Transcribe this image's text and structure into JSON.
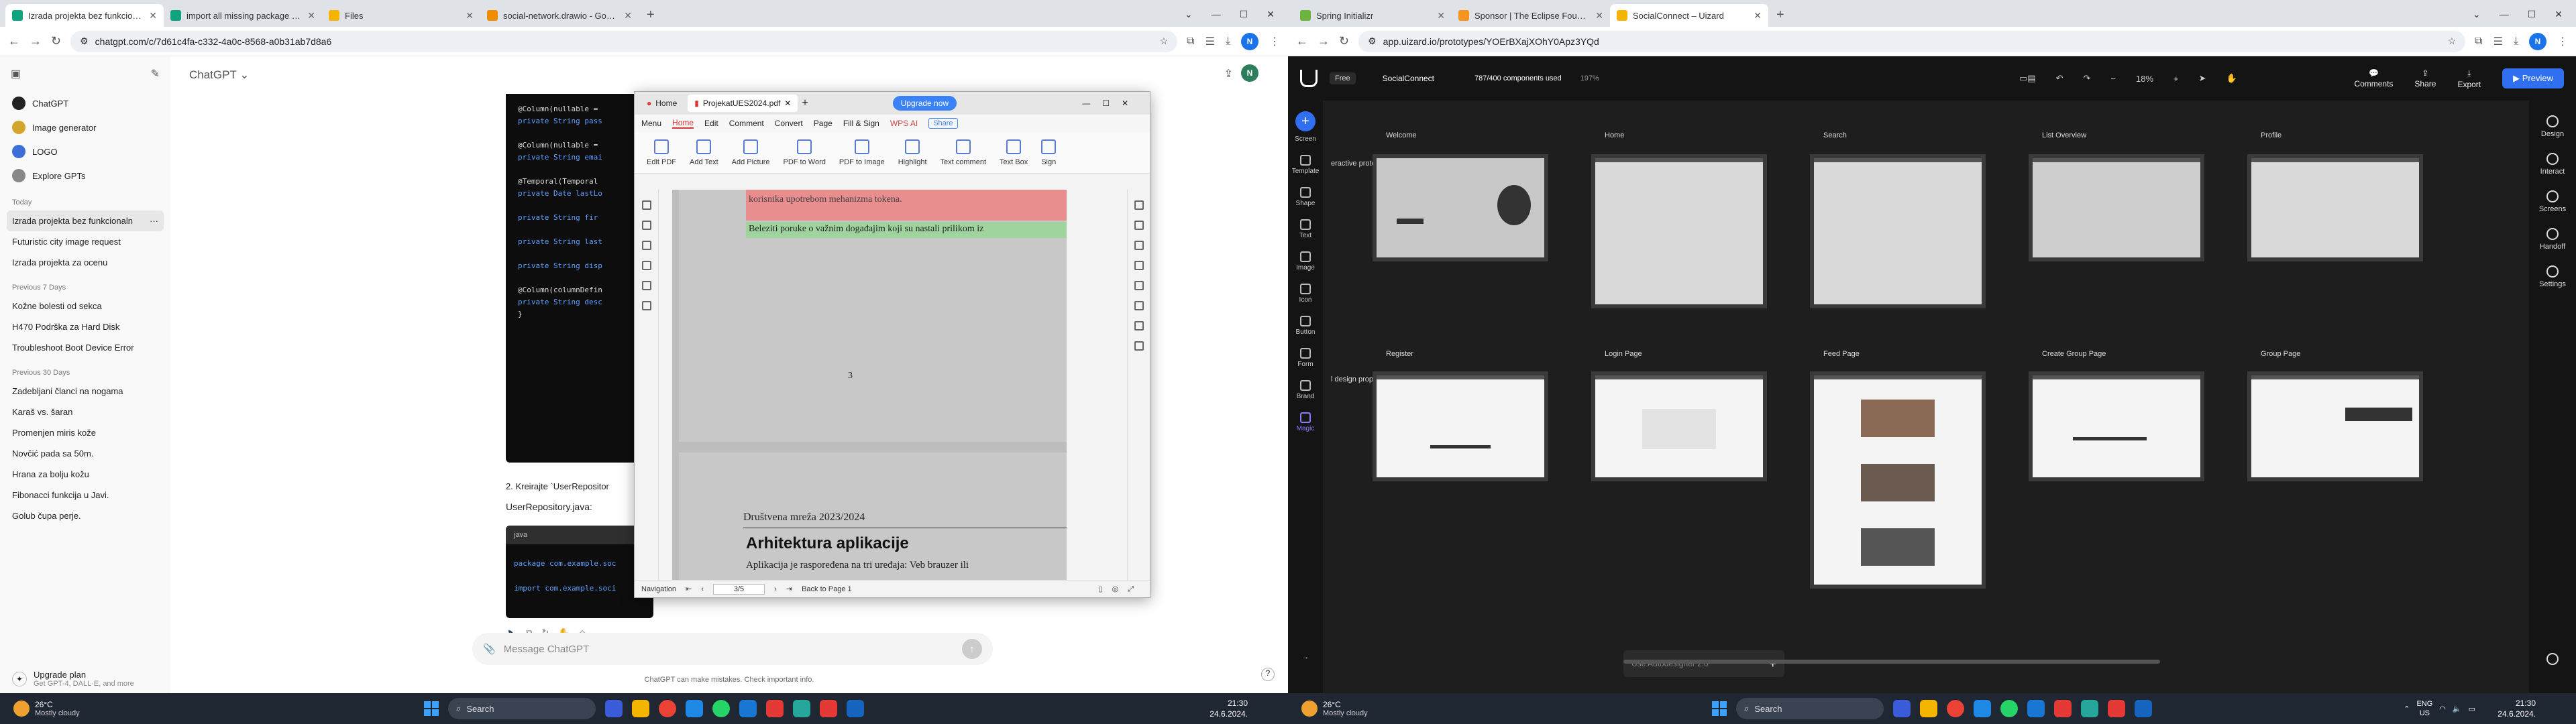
{
  "left": {
    "tabs": [
      {
        "title": "Izrada projekta bez funkcionalnosti",
        "color": "#10a37f",
        "active": true
      },
      {
        "title": "import all missing package w...",
        "color": "#10a37f"
      },
      {
        "title": "Files",
        "color": "#f4b400"
      },
      {
        "title": "social-network.drawio - Goog...",
        "color": "#f08c00"
      }
    ],
    "new_tab": "+",
    "window": {
      "minimize": "—",
      "maximize": "☐",
      "close": "✕",
      "tabsearch": "⌄"
    },
    "url": "chatgpt.com/c/7d61c4fa-c332-4a0c-8568-a0b31ab7d8a6",
    "avatar": "N",
    "sidebar": {
      "pinned": [
        {
          "label": "ChatGPT",
          "color": "#222"
        },
        {
          "label": "Image generator",
          "color": "#d4a52c"
        },
        {
          "label": "LOGO",
          "color": "#3d6fd8"
        },
        {
          "label": "Explore GPTs",
          "color": "#888"
        }
      ],
      "today_header": "Today",
      "today": [
        "Izrada projekta bez funkcionaln",
        "Futuristic city image request",
        "Izrada projekta za ocenu"
      ],
      "prev7_header": "Previous 7 Days",
      "prev7": [
        "Kožne bolesti od sekса",
        "H470 Podrška za Hard Disk",
        "Troubleshoot Boot Device Error"
      ],
      "prev30_header": "Previous 30 Days",
      "prev30": [
        "Zadebljani članci na nogama",
        "Karaš vs. šaran",
        "Promenjen miris kože",
        "Novčić pada sa 50m.",
        "Hrana za bolju kožu",
        "Fibonacci funkcija u Javi.",
        "Golub čupa perje."
      ],
      "upgrade_title": "Upgrade plan",
      "upgrade_sub": "Get GPT-4, DALL·E, and more"
    },
    "chat": {
      "title": "ChatGPT ⌄",
      "code_lines": [
        {
          "a": "@Column(nullable =",
          "b": ""
        },
        {
          "a": "private String pass",
          "b": ""
        },
        {
          "a": "",
          "b": ""
        },
        {
          "a": "@Column(nullable =",
          "b": ""
        },
        {
          "a": "private String emai",
          "b": ""
        },
        {
          "a": "",
          "b": ""
        },
        {
          "a": "@Temporal(Temporal",
          "b": ""
        },
        {
          "a": "private Date lastLo",
          "b": ""
        },
        {
          "a": "",
          "b": ""
        },
        {
          "a": "private String fir",
          "b": ""
        },
        {
          "a": "",
          "b": ""
        },
        {
          "a": "private String last",
          "b": ""
        },
        {
          "a": "",
          "b": ""
        },
        {
          "a": "private String disp",
          "b": ""
        },
        {
          "a": "",
          "b": ""
        },
        {
          "a": "@Column(columnDefin",
          "b": ""
        },
        {
          "a": "private String desc",
          "b": ""
        },
        {
          "a": "}",
          "b": ""
        }
      ],
      "step2": "2. Kreirajte `UserRepositor",
      "step2_file": "UserRepository.java:",
      "code2_lang": "java",
      "code2_l1": "package com.example.soc",
      "code2_l2": "import com.example.soci",
      "msg_placeholder": "Message ChatGPT",
      "disclaimer": "ChatGPT can make mistakes. Check important info.",
      "help": "?"
    },
    "wps": {
      "tab_home": "Home",
      "tab_doc": "ProjekatUES2024.pdf",
      "upgrade": "Upgrade now",
      "menu": [
        "Menu",
        "Home",
        "Edit",
        "Comment",
        "Convert",
        "Page",
        "Fill & Sign"
      ],
      "wps_ai": "WPS AI",
      "share": "Share",
      "tools": [
        "Edit PDF",
        "Add Text",
        "Add Picture",
        "PDF to Word",
        "PDF to Image",
        "Highlight",
        "Text comment",
        "Text Box",
        "Sign"
      ],
      "page_red": "korisnika upotrebom mehanizma tokena.",
      "page_green": "Beleziti poruke o važnim događajim koji su nastali prilikom iz",
      "page_num": "3",
      "page2_header": "Društvena mreža 2023/2024",
      "page2_title": "Arhitektura aplikacije",
      "page2_text": "Aplikacija je raspoređena na tri uređaja: Veb brauzer ili",
      "status_nav": "Navigation",
      "status_page": "3/5",
      "status_back": "Back to Page 1"
    }
  },
  "right": {
    "tabs": [
      {
        "title": "Spring Initializr",
        "color": "#6db33f"
      },
      {
        "title": "Sponsor | The Eclipse Foundati...",
        "color": "#f7941e"
      },
      {
        "title": "SocialConnect – Uizard",
        "color": "#f4b400",
        "active": true
      }
    ],
    "url": "app.uizard.io/prototypes/YOErBXajXOhY0Apz3YQd",
    "uizard": {
      "free": "Free",
      "project": "SocialConnect",
      "components": "787/400 components used",
      "pct": "197%",
      "zoom": "18%",
      "right_actions": [
        "Comments",
        "Share",
        "Export"
      ],
      "preview": "Preview",
      "left_panel": [
        "Screen",
        "Template",
        "Shape",
        "Text",
        "Image",
        "Icon",
        "Button",
        "Form",
        "Brand",
        "Magic"
      ],
      "right_panel": [
        "Design",
        "Interact",
        "Screens",
        "Handoff",
        "Settings"
      ],
      "side_label_1": "eractive prototype",
      "side_label_2": "l design proposals",
      "row1": [
        "Welcome",
        "Home",
        "Search",
        "List Overview",
        "Profile"
      ],
      "row2": [
        "Register",
        "Login Page",
        "Feed Page",
        "Create Group Page",
        "Group Page"
      ],
      "ai_placeholder": "Use Autodesigner 2.0",
      "ai_plus": "+"
    }
  },
  "taskbar": {
    "temp": "26°C",
    "weather": "Mostly cloudy",
    "search": "Search",
    "time": "21:30",
    "date": "24.6.2024.",
    "lang": "ENG",
    "region": "US"
  }
}
